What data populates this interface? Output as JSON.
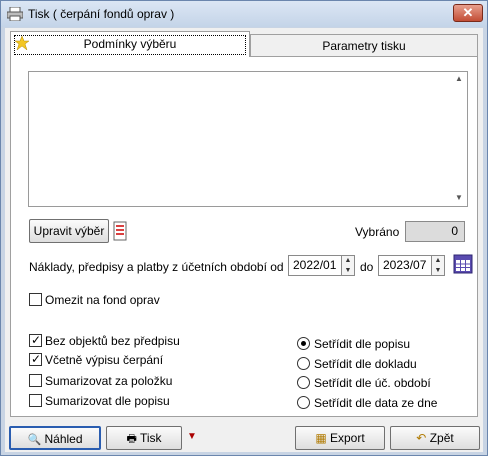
{
  "window": {
    "title": "Tisk ( čerpání fondů oprav )",
    "close_label": "✕"
  },
  "tabs": [
    {
      "label": "Podmínky výběru"
    },
    {
      "label": "Parametry tisku"
    }
  ],
  "selection": {
    "edit_button": "Upravit výběr",
    "selected_label": "Vybráno",
    "selected_count": "0"
  },
  "period": {
    "label": "Náklady, předpisy a platby z účetních období od",
    "from": "2022/01",
    "to_label": "do",
    "to": "2023/07"
  },
  "options": {
    "fund_limit": {
      "label": "Omezit na fond oprav",
      "checked": false
    },
    "checkboxes": [
      {
        "label": "Bez objektů bez předpisu",
        "checked": true
      },
      {
        "label": "Včetně výpisu čerpání",
        "checked": true
      },
      {
        "label": "Sumarizovat za položku",
        "checked": false
      },
      {
        "label": "Sumarizovat dle popisu",
        "checked": false
      }
    ],
    "radios": [
      {
        "label": "Setřídit dle popisu",
        "selected": true
      },
      {
        "label": "Setřídit dle dokladu",
        "selected": false
      },
      {
        "label": "Setřídit dle úč. období",
        "selected": false
      },
      {
        "label": "Setřídit dle data ze dne",
        "selected": false
      }
    ]
  },
  "footer": {
    "preview": "Náhled",
    "print": "Tisk",
    "export": "Export",
    "back": "Zpět"
  }
}
